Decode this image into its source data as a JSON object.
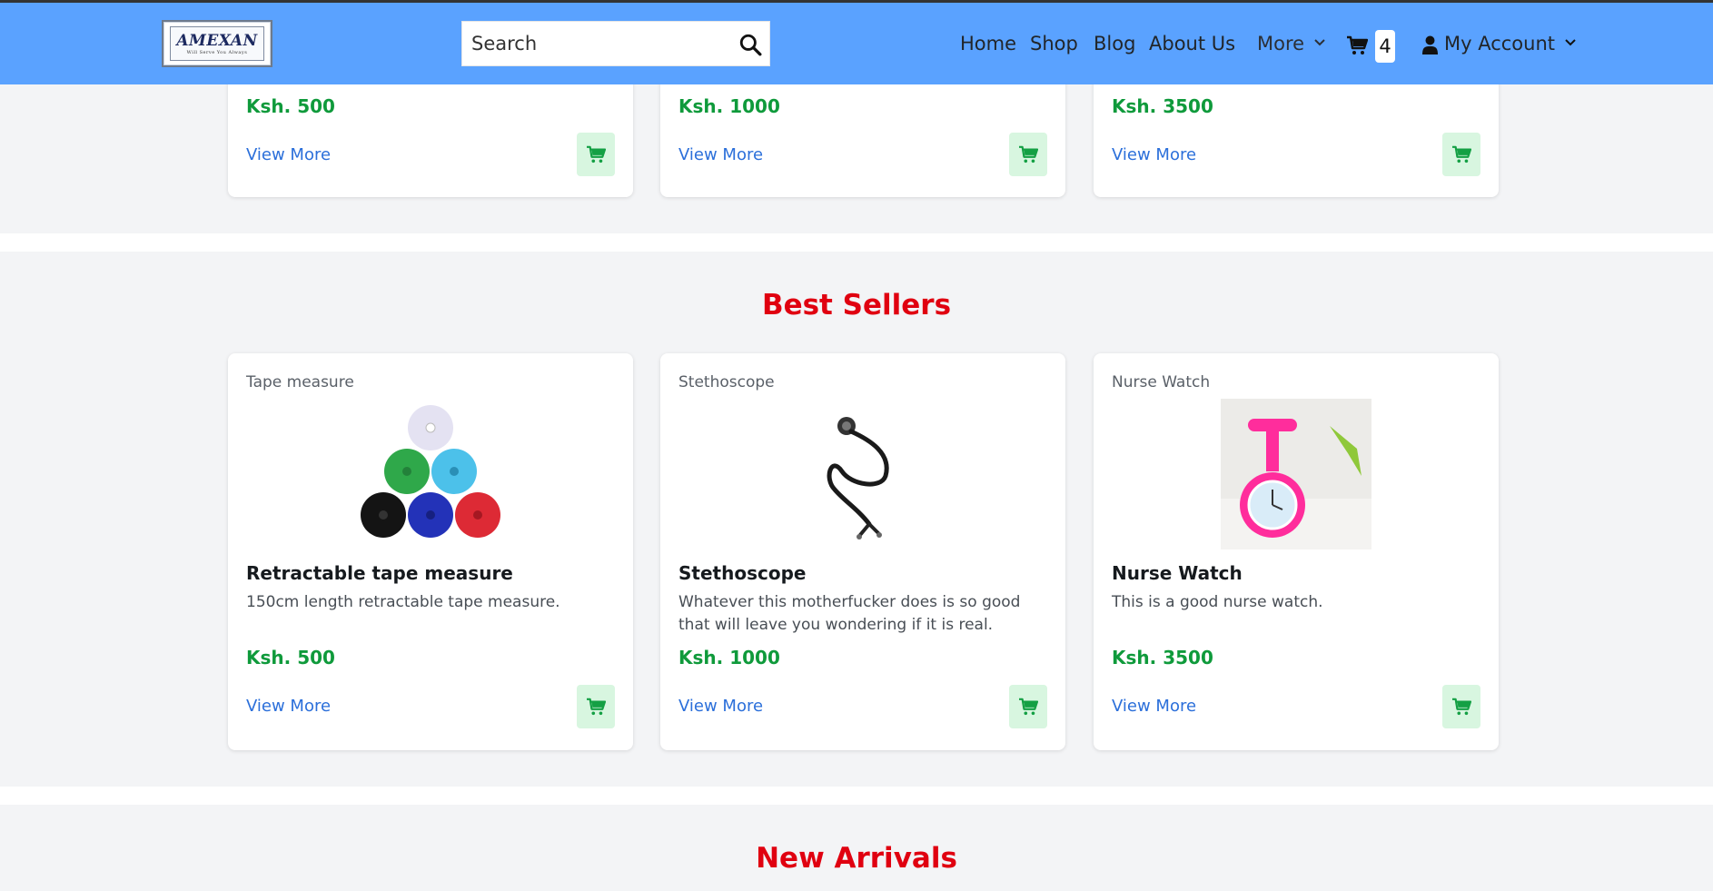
{
  "header": {
    "logo_text": "AMEXAN",
    "logo_tagline": "Will Serve You Always",
    "search_placeholder": "Search",
    "nav": {
      "home": "Home",
      "shop": "Shop",
      "blog": "Blog",
      "about": "About Us",
      "more": "More",
      "cart_count": "4",
      "account": "My Account"
    }
  },
  "top_section": {
    "cards": [
      {
        "price": "Ksh. 500",
        "link": "View More"
      },
      {
        "price": "Ksh. 1000",
        "link": "View More"
      },
      {
        "price": "Ksh. 3500",
        "link": "View More"
      }
    ]
  },
  "best_sellers": {
    "title": "Best Sellers",
    "cards": [
      {
        "category": "Tape measure",
        "name": "Retractable tape measure",
        "description": "150cm length retractable tape measure.",
        "price": "Ksh. 500",
        "link": "View More"
      },
      {
        "category": "Stethoscope",
        "name": "Stethoscope",
        "description": "Whatever this motherfucker does is so good that will leave you wondering if it is real.",
        "price": "Ksh. 1000",
        "link": "View More"
      },
      {
        "category": "Nurse Watch",
        "name": "Nurse Watch",
        "description": "This is a good nurse watch.",
        "price": "Ksh. 3500",
        "link": "View More"
      }
    ]
  },
  "new_arrivals": {
    "title": "New Arrivals"
  },
  "colors": {
    "navbar": "#5aa2ff",
    "heading": "#e00010",
    "price": "#0f9a3b",
    "link": "#2b6fda",
    "cart_button_bg": "#d8f6e0"
  },
  "icons": [
    "search-icon",
    "cart-icon",
    "user-icon",
    "chevron-down-icon"
  ]
}
